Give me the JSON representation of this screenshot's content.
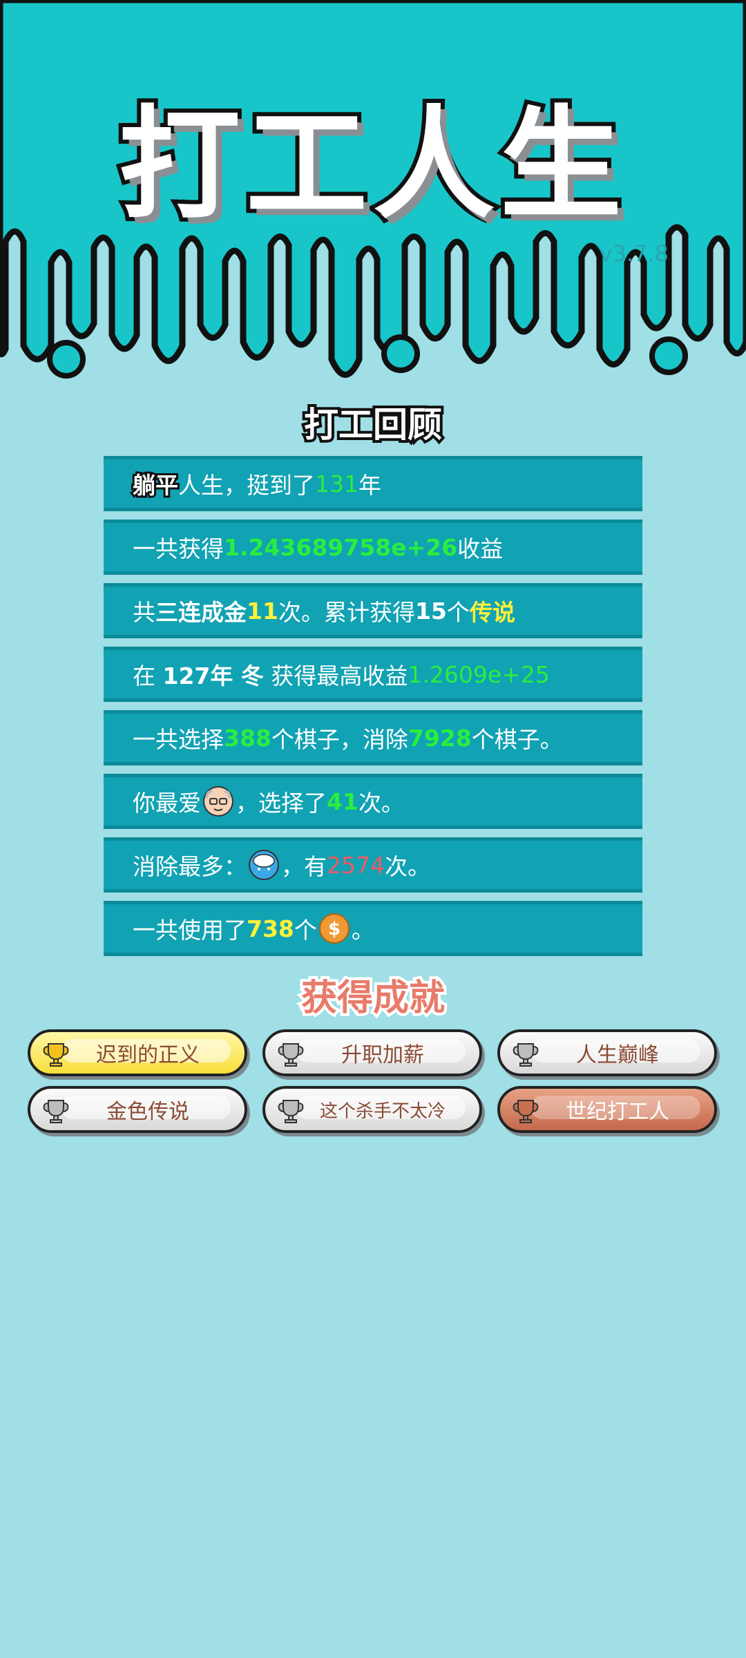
{
  "app": {
    "title": "打工人生",
    "version": "v3.7.8"
  },
  "review": {
    "heading": "打工回顾",
    "rows": [
      {
        "a": "躺平",
        "b": "人生，挺到了",
        "c": "131",
        "d": "年"
      },
      {
        "a": "一共获得",
        "b": "1.243689758e+26",
        "c": "收益"
      },
      {
        "a": "共",
        "b": "三连成金",
        "c": "11",
        "d": "次。累计获得",
        "e": "15",
        "f": "个",
        "g": "传说"
      },
      {
        "a": "在 ",
        "b": "127年 冬",
        "c": " 获得最高收益",
        "d": "1.2609e+25"
      },
      {
        "a": "一共选择",
        "b": "388",
        "c": "个棋子，消除",
        "d": "7928",
        "e": "个棋子。"
      },
      {
        "a": "你最爱",
        "b": "，选择了",
        "c": "41",
        "d": "次。"
      },
      {
        "a": "消除最多：",
        "b": "，有",
        "c": "2574",
        "d": "次。"
      },
      {
        "a": "一共使用了",
        "b": "738",
        "c": "个",
        "d": "。"
      }
    ],
    "icons": [
      "old-man-face-icon",
      "rice-bowl-icon",
      "coin-icon"
    ]
  },
  "achievements": {
    "heading": "获得成就",
    "items": [
      {
        "label": "迟到的正义",
        "tier": "gold"
      },
      {
        "label": "升职加薪",
        "tier": "silver"
      },
      {
        "label": "人生巅峰",
        "tier": "silver"
      },
      {
        "label": "金色传说",
        "tier": "silver"
      },
      {
        "label": "这个杀手不太冷",
        "tier": "silver"
      },
      {
        "label": "世纪打工人",
        "tier": "bronze"
      }
    ]
  },
  "colors": {
    "header_teal": "#18c6c9",
    "background": "#9fdfe5",
    "row_bg": "#11a2b3",
    "green": "#29ee3f",
    "yellow": "#fff13a",
    "red": "#ee5a66"
  }
}
